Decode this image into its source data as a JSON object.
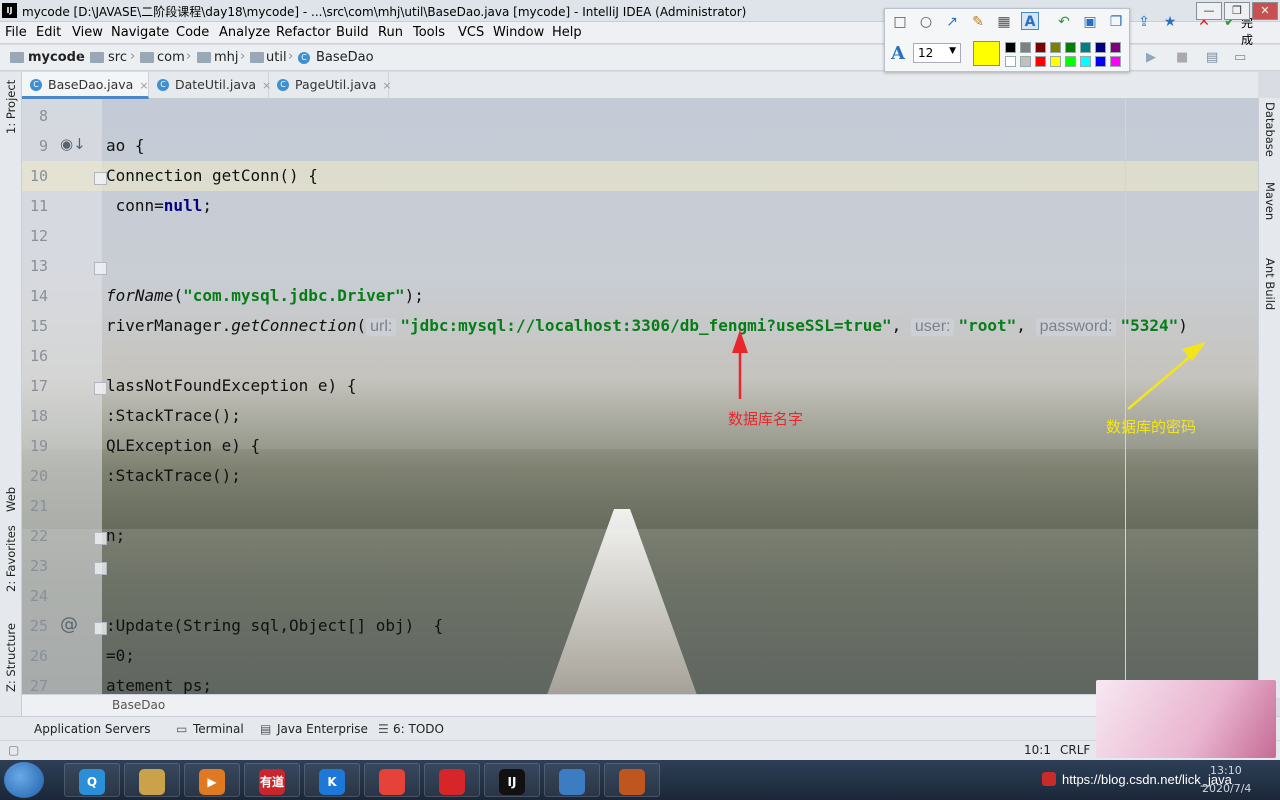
{
  "window": {
    "title": "mycode [D:\\JAVASE\\二阶段课程\\day18\\mycode] - ...\\src\\com\\mhj\\util\\BaseDao.java [mycode] - IntelliJ IDEA (Administrator)",
    "logo": "IJ"
  },
  "menu": [
    "File",
    "Edit",
    "View",
    "Navigate",
    "Code",
    "Analyze",
    "Refactor",
    "Build",
    "Run",
    "Tools",
    "VCS",
    "Window",
    "Help"
  ],
  "breadcrumbs": [
    "mycode",
    "src",
    "com",
    "mhj",
    "util",
    "BaseDao"
  ],
  "tabs": [
    {
      "label": "BaseDao.java",
      "active": true,
      "close": "×"
    },
    {
      "label": "DateUtil.java",
      "active": false,
      "close": "×"
    },
    {
      "label": "PageUtil.java",
      "active": false,
      "close": "×"
    }
  ],
  "left_tools": [
    "1: Project",
    "Web",
    "2: Favorites",
    "Z: Structure"
  ],
  "right_tools": [
    "Database",
    "Maven",
    "Ant Build"
  ],
  "editor": {
    "lines": [
      {
        "n": "8",
        "code": ""
      },
      {
        "n": "9",
        "code": "ao {"
      },
      {
        "n": "10",
        "code": "Connection getConn() {"
      },
      {
        "n": "11",
        "code": " conn=",
        "kw": "null",
        ";": ";"
      },
      {
        "n": "12",
        "code": ""
      },
      {
        "n": "13",
        "code": ""
      },
      {
        "n": "14",
        "pre": "",
        "it": "forName",
        "mid": "(",
        "str": "\"com.mysql.jdbc.Driver\"",
        "post": ");"
      },
      {
        "n": "15",
        "pre": "riverManager.",
        "it": "getConnection",
        "mid": "("
      },
      {
        "n": "16",
        "code": ""
      },
      {
        "n": "17",
        "code": "lassNotFoundException e) {"
      },
      {
        "n": "18",
        "code": ":StackTrace();"
      },
      {
        "n": "19",
        "code": "QLException e) {"
      },
      {
        "n": "20",
        "code": ":StackTrace();"
      },
      {
        "n": "21",
        "code": ""
      },
      {
        "n": "22",
        "code": "n;"
      },
      {
        "n": "23",
        "code": ""
      },
      {
        "n": "24",
        "code": ""
      },
      {
        "n": "25",
        "code": ":Update(String sql,Object[] obj)  {"
      },
      {
        "n": "26",
        "code": "=0;"
      },
      {
        "n": "27",
        "code": "atement ps;"
      }
    ],
    "line15": {
      "hint_url": "url:",
      "url": "\"jdbc:mysql://localhost:3306/db_fengmi?useSSL=true\"",
      "comma1": ",",
      "hint_user": "user:",
      "user": "\"root\"",
      "comma2": ",",
      "hint_password": "password:",
      "password": "\"5324\"",
      "close": ")"
    },
    "line11_kw": "null",
    "footer_crumb": "BaseDao"
  },
  "annotations": {
    "db_name": {
      "text": "数据库名字",
      "color": "#e8262b"
    },
    "db_password": {
      "text": "数据库的密码",
      "color": "#f2e61b"
    }
  },
  "snap_toolbar": {
    "font_size": "12",
    "done_label": "完成",
    "font_icon": "A",
    "selected_color": "#ffff00",
    "palette": [
      "#000000",
      "#808080",
      "#800000",
      "#808000",
      "#008000",
      "#008080",
      "#000080",
      "#800080",
      "#ffffff",
      "#c0c0c0",
      "#ff0000",
      "#ffff00",
      "#00ff00",
      "#00ffff",
      "#0000ff",
      "#ff00ff"
    ]
  },
  "bottom_tools": [
    "Application Servers",
    "Terminal",
    "Java Enterprise",
    "6: TODO"
  ],
  "status": {
    "position": "10:1",
    "line_sep": "CRLF"
  },
  "taskbar": {
    "watermark": "https://blog.csdn.net/lick_java",
    "clock_time": "13:10",
    "clock_date": "2020/7/4",
    "apps": [
      {
        "name": "qq-browser",
        "label": "Q",
        "color": "#2a8fd6"
      },
      {
        "name": "explorer",
        "label": "",
        "color": "#c9a24a"
      },
      {
        "name": "media-player",
        "label": "▶",
        "color": "#e07a22"
      },
      {
        "name": "youdao",
        "label": "有道",
        "color": "#c9252c"
      },
      {
        "name": "kugou",
        "label": "K",
        "color": "#1e78d8"
      },
      {
        "name": "chrome",
        "label": "",
        "color": "#e5433a"
      },
      {
        "name": "netease-music",
        "label": "",
        "color": "#d6262a"
      },
      {
        "name": "intellij",
        "label": "IJ",
        "color": "#111111"
      },
      {
        "name": "photo-viewer",
        "label": "",
        "color": "#3c7cc0"
      },
      {
        "name": "other-app",
        "label": "",
        "color": "#c0561f"
      }
    ]
  }
}
